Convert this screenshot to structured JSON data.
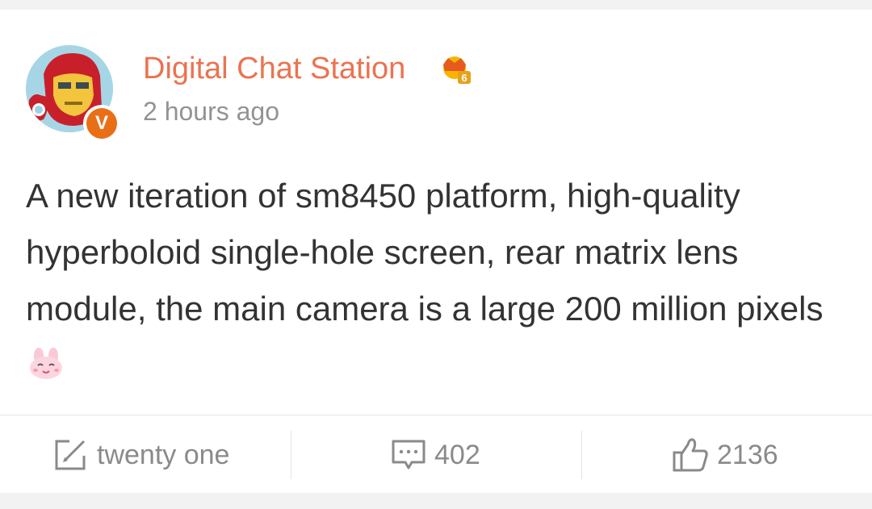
{
  "post": {
    "author": "Digital Chat Station",
    "verified_badge": "V",
    "timestamp": "2 hours ago",
    "text": "A new iteration of sm8450 platform, high-quality hyperboloid single-hole screen, rear matrix lens module, the main camera is a large 200 million pixels",
    "text_emoji": "bunny-smile-emoji"
  },
  "actions": {
    "share": {
      "label": "twenty one",
      "icon": "share-edit-icon"
    },
    "comment": {
      "label": "402",
      "icon": "comment-icon"
    },
    "like": {
      "label": "2136",
      "icon": "thumbs-up-icon"
    }
  },
  "colors": {
    "author": "#eb7350",
    "timestamp": "#939393",
    "body_text": "#333333",
    "action_text": "#8a8a8a",
    "verified": "#e96f16",
    "background": "#f2f2f2"
  }
}
